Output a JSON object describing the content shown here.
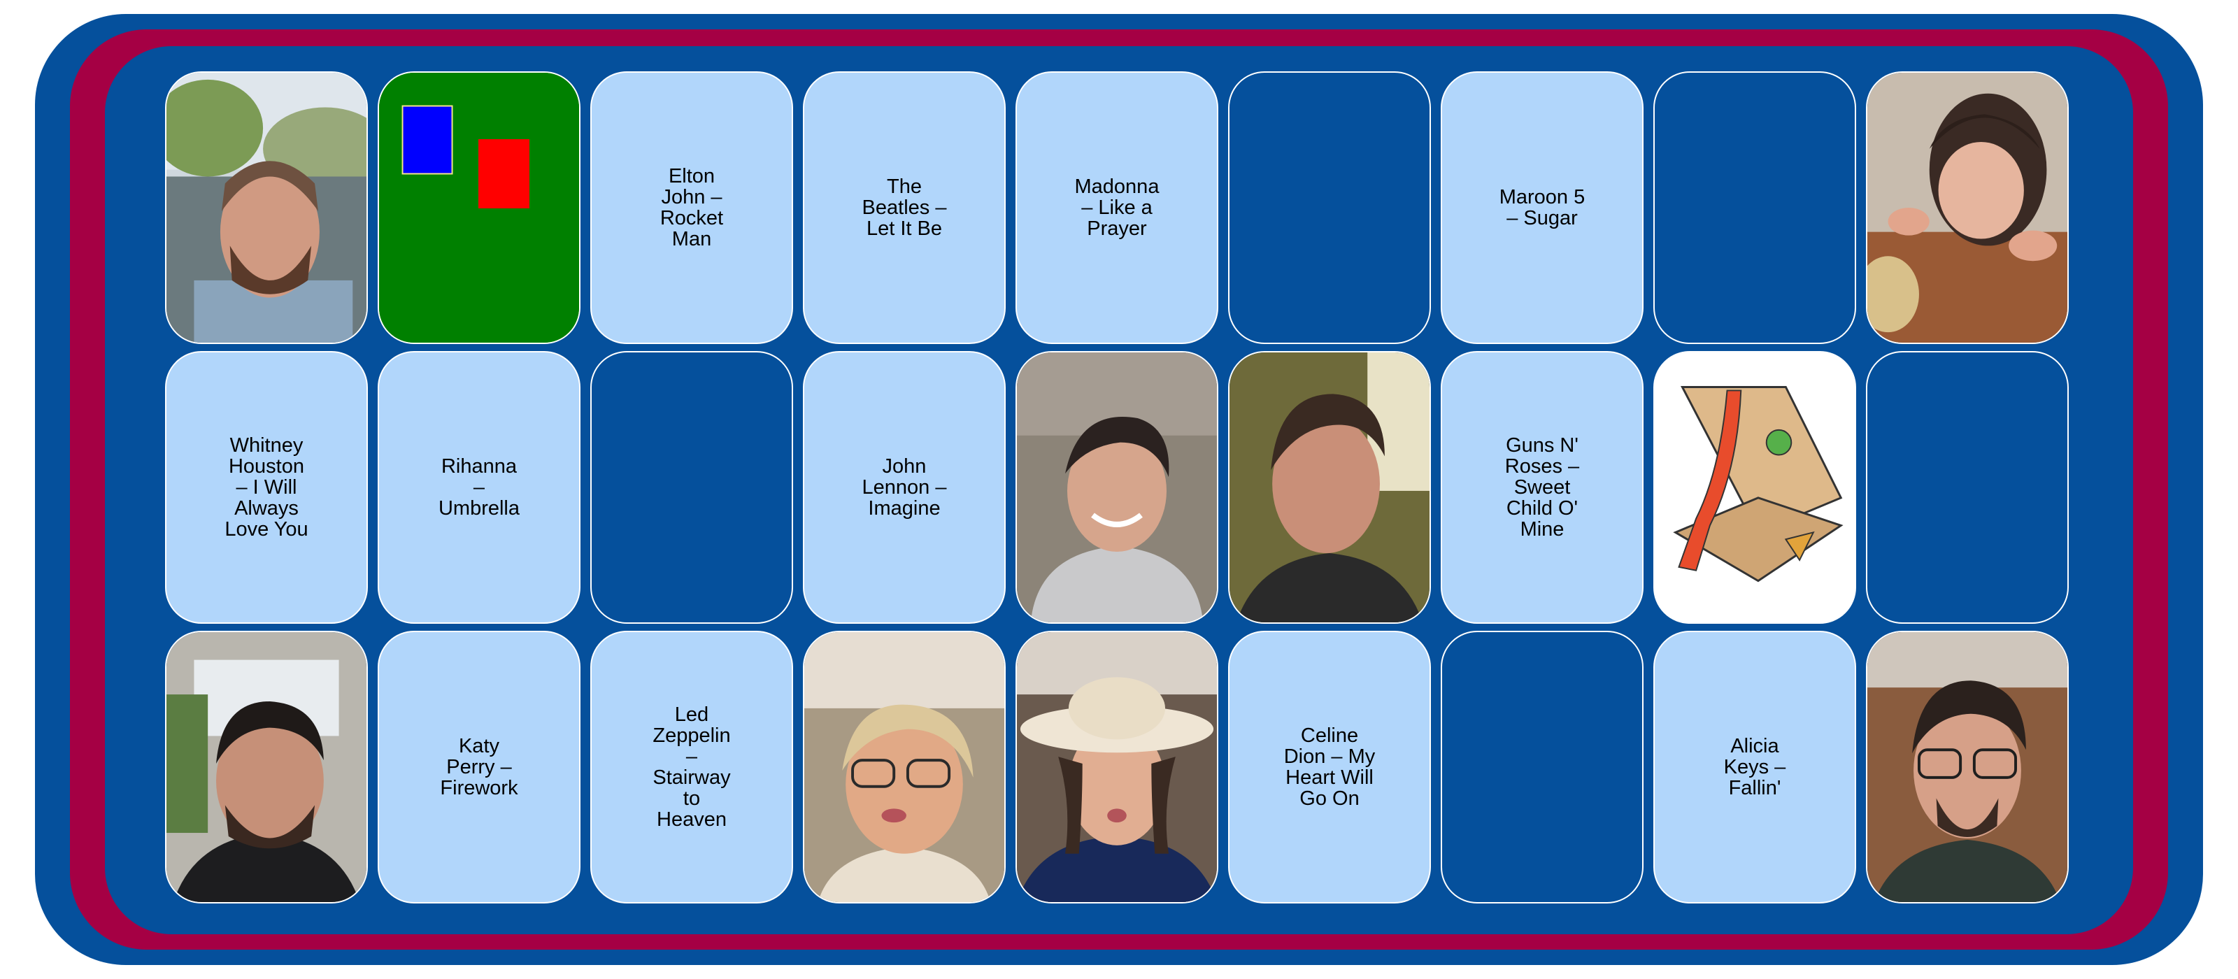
{
  "palette": {
    "frame_blue": "#05509c",
    "frame_red": "#a50044",
    "card_light_blue": "#b1d6fb",
    "card_border": "#ffffff"
  },
  "board": {
    "rows": 3,
    "columns": 9,
    "cards": [
      {
        "type": "photo",
        "icon": "photo-bearded-man-outdoors"
      },
      {
        "type": "color-swatch",
        "icon": "blue-red-cards-on-green"
      },
      {
        "type": "song",
        "label": "Elton John – Rocket Man"
      },
      {
        "type": "song",
        "label": "The Beatles – Let It Be"
      },
      {
        "type": "song",
        "label": "Madonna – Like a Prayer"
      },
      {
        "type": "blank"
      },
      {
        "type": "song",
        "label": "Maroon 5 – Sugar"
      },
      {
        "type": "blank"
      },
      {
        "type": "photo",
        "icon": "photo-smiling-woman-table"
      },
      {
        "type": "song",
        "label": "Whitney Houston – I Will Always Love You"
      },
      {
        "type": "song",
        "label": "Rihanna – Umbrella"
      },
      {
        "type": "blank"
      },
      {
        "type": "song",
        "label": "John Lennon – Imagine"
      },
      {
        "type": "photo",
        "icon": "photo-smiling-person-hoodie"
      },
      {
        "type": "photo",
        "icon": "photo-young-man-portrait"
      },
      {
        "type": "song",
        "label": "Guns N' Roses – Sweet Child O' Mine"
      },
      {
        "type": "illustration",
        "icon": "pizza-box-illustration"
      },
      {
        "type": "blank"
      },
      {
        "type": "photo",
        "icon": "photo-man-kiss-face"
      },
      {
        "type": "song",
        "label": "Katy Perry – Firework"
      },
      {
        "type": "song",
        "label": "Led Zeppelin – Stairway to Heaven"
      },
      {
        "type": "photo",
        "icon": "photo-blonde-woman-glasses"
      },
      {
        "type": "photo",
        "icon": "photo-woman-cowboy-hat"
      },
      {
        "type": "song",
        "label": "Celine Dion – My Heart Will Go On"
      },
      {
        "type": "blank"
      },
      {
        "type": "song",
        "label": "Alicia Keys – Fallin'"
      },
      {
        "type": "photo",
        "icon": "photo-man-glasses-smiling"
      }
    ]
  }
}
